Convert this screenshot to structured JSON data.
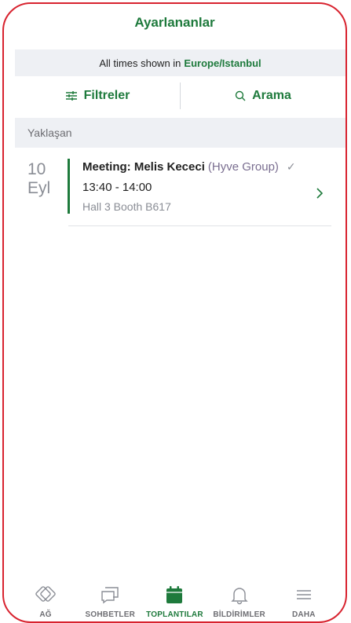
{
  "header": {
    "title": "Ayarlananlar"
  },
  "timezone": {
    "prefix": "All times shown in",
    "zone": "Europe/Istanbul"
  },
  "filters": {
    "filter_label": "Filtreler",
    "search_label": "Arama"
  },
  "section": {
    "title": "Yaklaşan"
  },
  "meeting": {
    "day": "10",
    "month": "Eyl",
    "title": "Meeting: Melis Kececi",
    "organization": "(Hyve Group)",
    "time": "13:40 - 14:00",
    "location": "Hall 3 Booth B617",
    "status_icon": "check-icon"
  },
  "tabs": [
    {
      "label": "AĞ",
      "icon": "network-icon",
      "active": false
    },
    {
      "label": "SOHBETLER",
      "icon": "chat-icon",
      "active": false
    },
    {
      "label": "TOPLANTILAR",
      "icon": "calendar-icon",
      "active": true
    },
    {
      "label": "BİLDİRİMLER",
      "icon": "bell-icon",
      "active": false
    },
    {
      "label": "DAHA",
      "icon": "menu-icon",
      "active": false
    }
  ],
  "colors": {
    "accent": "#1e7a3c",
    "frame": "#d8232f",
    "muted": "#8a8d95"
  }
}
